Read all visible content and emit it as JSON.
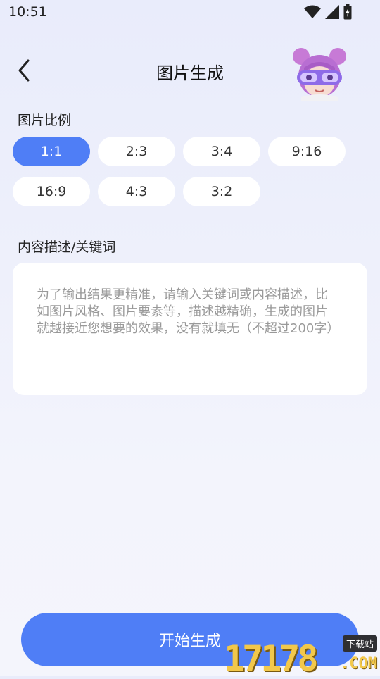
{
  "status": {
    "time": "10:51",
    "icons": [
      "wifi-icon",
      "signal-icon",
      "battery-icon"
    ]
  },
  "header": {
    "title": "图片生成",
    "back_icon": "chevron-left-icon",
    "avatar": "avatar-girl-goggles"
  },
  "ratio": {
    "label": "图片比例",
    "options": [
      "1:1",
      "2:3",
      "3:4",
      "9:16",
      "16:9",
      "4:3",
      "3:2"
    ],
    "selected": "1:1"
  },
  "description": {
    "label": "内容描述/关键词",
    "placeholder": "为了输出结果更精准，请输入关键词或内容描述，比如图片风格、图片要素等，描述越精确，生成的图片就越接近您想要的效果，没有就填无（不超过200字）",
    "value": ""
  },
  "actions": {
    "start_label": "开始生成"
  },
  "watermark": {
    "digits": "17178",
    "tag": "下载站",
    "suffix": ".COM"
  },
  "colors": {
    "accent": "#4f7ef6",
    "background": "#eef0fb"
  }
}
